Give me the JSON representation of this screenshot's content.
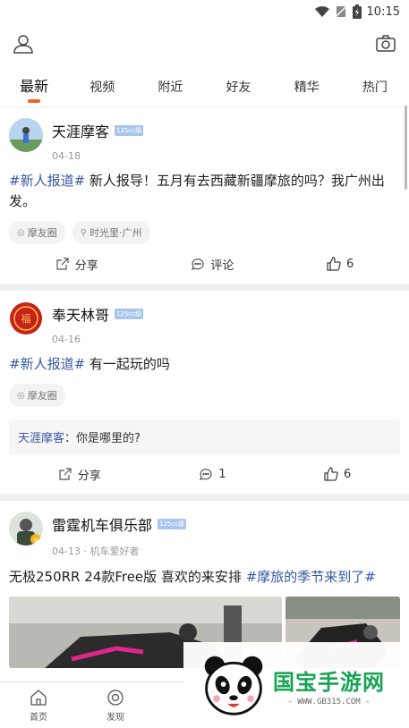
{
  "status_bar": {
    "time": "10:15"
  },
  "tabs": [
    {
      "label": "最新",
      "active": true
    },
    {
      "label": "视频"
    },
    {
      "label": "附近"
    },
    {
      "label": "好友"
    },
    {
      "label": "精华"
    },
    {
      "label": "热门"
    }
  ],
  "posts": [
    {
      "user": "天涯摩客",
      "badge": "125cc级",
      "date": "04-18",
      "hashtag": "#新人报道#",
      "text": " 新人报导！五月有去西藏新疆摩旅的吗？我广州出发。",
      "chips": [
        "摩友圈",
        "时光里·广州"
      ],
      "share": "分享",
      "comment": "评论",
      "likes": "6"
    },
    {
      "user": "奉天林哥",
      "badge": "125cc级",
      "date": "04-16",
      "hashtag": "#新人报道#",
      "text": " 有一起玩的吗",
      "chips": [
        "摩友圈"
      ],
      "comment_preview": {
        "name": "天涯摩客",
        "text": "：你是哪里的?"
      },
      "share": "分享",
      "comment": "1",
      "likes": "6"
    },
    {
      "user": "雷霆机车俱乐部",
      "badge": "125cc级",
      "date": "04-13 · 机车爱好者",
      "text": "无极250RR 24款Free版 喜欢的来安排 ",
      "hashtag": "#摩旅的季节来到了#"
    }
  ],
  "bottom_nav": [
    {
      "label": "首页",
      "icon": "home-icon"
    },
    {
      "label": "发现",
      "icon": "discover-icon"
    }
  ],
  "watermark": {
    "title": "国宝手游网",
    "url": "- WWW.GB315.COM -"
  },
  "colors": {
    "accent": "#f26522",
    "tag": "#3a56a6",
    "badge": "#a9c7ee",
    "watermark": "#18a352"
  }
}
